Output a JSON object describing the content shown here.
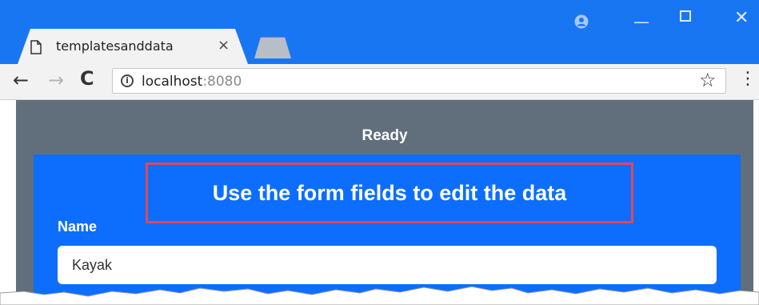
{
  "browser": {
    "tab": {
      "title": "templatesanddata",
      "close_glyph": "×",
      "icon": "document-icon"
    },
    "window_controls": {
      "profile_icon": "profile-icon",
      "minimize_glyph": "—",
      "close_glyph": "✕"
    },
    "toolbar": {
      "back_glyph": "←",
      "forward_glyph": "→",
      "reload_glyph": "C",
      "info_glyph": "i",
      "url_host": "localhost",
      "url_port": ":8080",
      "star_glyph": "☆",
      "menu_glyph": "⋮"
    },
    "colors": {
      "titlebar": "#1976f2",
      "page_background": "#606f7b",
      "panel": "#0d6efd",
      "highlight_border": "#e0485a"
    }
  },
  "page": {
    "status": "Ready",
    "heading": "Use the form fields to edit the data",
    "form": {
      "name_label": "Name",
      "name_value": "Kayak"
    }
  }
}
